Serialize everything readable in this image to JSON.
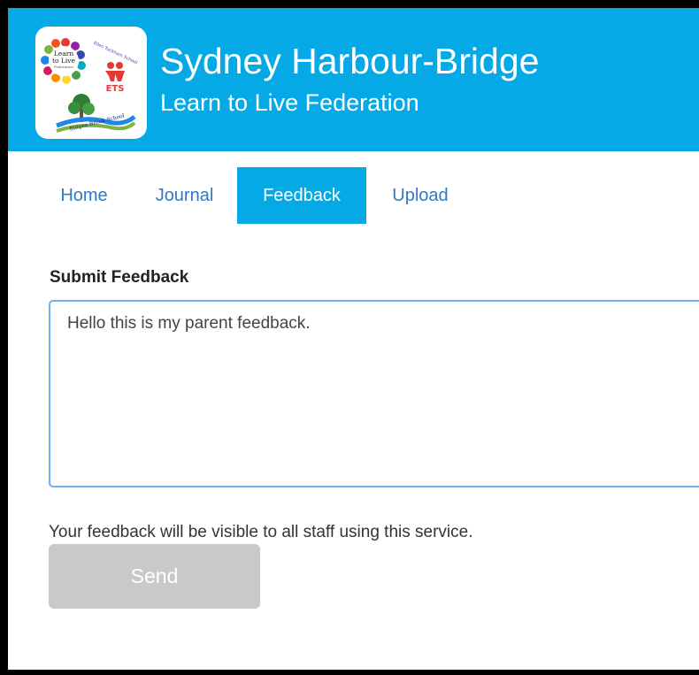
{
  "header": {
    "title": "Sydney Harbour-Bridge",
    "subtitle": "Learn to Live Federation",
    "logo": {
      "name": "learn-to-live-federation-logo",
      "text_lines": [
        "Learn",
        "to Live",
        "Federation"
      ],
      "badge_text": "ETS",
      "arc_text": "Ellen Tuckham School",
      "school_text": "Bidgee Brook School"
    }
  },
  "nav": {
    "items": [
      {
        "label": "Home",
        "active": false
      },
      {
        "label": "Journal",
        "active": false
      },
      {
        "label": "Feedback",
        "active": true
      },
      {
        "label": "Upload",
        "active": false
      }
    ]
  },
  "feedback_form": {
    "label": "Submit Feedback",
    "value": "Hello this is my parent feedback.",
    "help_text": "Your feedback will be visible to all staff using this service.",
    "send_label": "Send"
  },
  "colors": {
    "brand": "#05a9e6",
    "nav_link": "#2f7ac3",
    "disabled_button": "#c9c9c9",
    "input_border": "#6eaef1"
  }
}
